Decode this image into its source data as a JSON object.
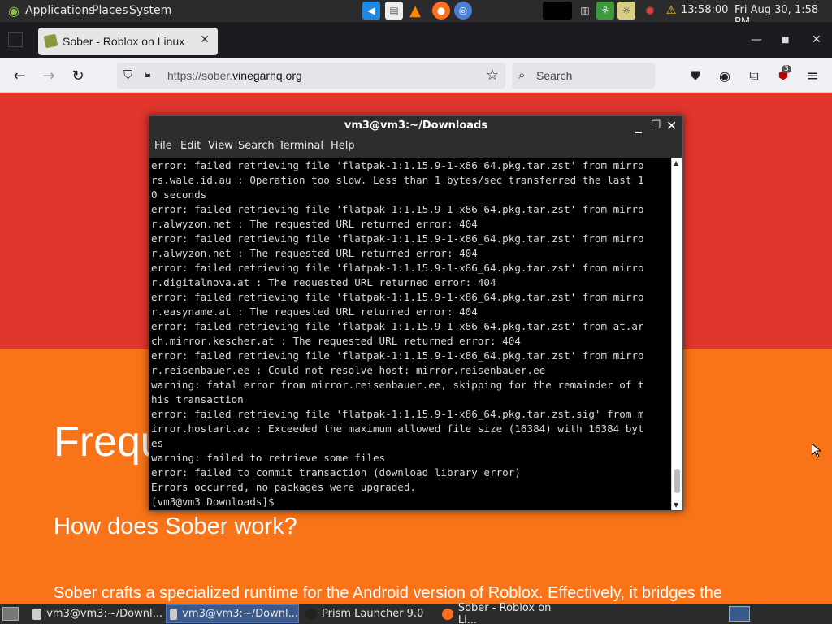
{
  "top_panel": {
    "menus": [
      "Applications",
      "Places",
      "System"
    ],
    "clock": "13:58:00",
    "date": "Fri Aug 30,  1:58 PM",
    "launchers": [
      "vscode-icon",
      "text-editor-icon",
      "vlc-icon",
      "firefox-icon",
      "chromium-icon"
    ],
    "tray": [
      "terminal-icon",
      "trash-icon",
      "image-viewer-icon",
      "weather-icon",
      "settings-icon",
      "alert-icon"
    ]
  },
  "browser": {
    "tab_title": "Sober - Roblox on Linux",
    "url_prefix": "https://sober.",
    "url_domain": "vinegarhq.org",
    "search_placeholder": "Search",
    "extension_badge": "3"
  },
  "page": {
    "faq_heading": "Frequ",
    "question": "How does Sober work?",
    "answer": "Sober crafts a specialized runtime for the Android version of Roblox. Effectively, it bridges the"
  },
  "terminal": {
    "title": "vm3@vm3:~/Downloads",
    "menus": [
      "File",
      "Edit",
      "View",
      "Search",
      "Terminal",
      "Help"
    ],
    "lines": [
      "error: failed retrieving file 'flatpak-1:1.15.9-1-x86_64.pkg.tar.zst' from mirro",
      "rs.wale.id.au : Operation too slow. Less than 1 bytes/sec transferred the last 1",
      "0 seconds",
      "error: failed retrieving file 'flatpak-1:1.15.9-1-x86_64.pkg.tar.zst' from mirro",
      "r.alwyzon.net : The requested URL returned error: 404",
      "error: failed retrieving file 'flatpak-1:1.15.9-1-x86_64.pkg.tar.zst' from mirro",
      "r.alwyzon.net : The requested URL returned error: 404",
      "error: failed retrieving file 'flatpak-1:1.15.9-1-x86_64.pkg.tar.zst' from mirro",
      "r.digitalnova.at : The requested URL returned error: 404",
      "error: failed retrieving file 'flatpak-1:1.15.9-1-x86_64.pkg.tar.zst' from mirro",
      "r.easyname.at : The requested URL returned error: 404",
      "error: failed retrieving file 'flatpak-1:1.15.9-1-x86_64.pkg.tar.zst' from at.ar",
      "ch.mirror.kescher.at : The requested URL returned error: 404",
      "error: failed retrieving file 'flatpak-1:1.15.9-1-x86_64.pkg.tar.zst' from mirro",
      "r.reisenbauer.ee : Could not resolve host: mirror.reisenbauer.ee",
      "warning: fatal error from mirror.reisenbauer.ee, skipping for the remainder of t",
      "his transaction",
      "error: failed retrieving file 'flatpak-1:1.15.9-1-x86_64.pkg.tar.zst.sig' from m",
      "irror.hostart.az : Exceeded the maximum allowed file size (16384) with 16384 byt",
      "es",
      "warning: failed to retrieve some files",
      "error: failed to commit transaction (download library error)",
      "Errors occurred, no packages were upgraded.",
      "[vm3@vm3 Downloads]$ "
    ]
  },
  "taskbar": {
    "tasks": [
      {
        "label": "vm3@vm3:~/Downl...",
        "icon": "terminal-icon",
        "active": false
      },
      {
        "label": "vm3@vm3:~/Downl...",
        "icon": "terminal-icon",
        "active": true
      },
      {
        "label": "Prism Launcher 9.0",
        "icon": "prism-icon",
        "active": false
      },
      {
        "label": "Sober - Roblox on Li...",
        "icon": "firefox-icon",
        "active": false
      }
    ]
  },
  "colors": {
    "page_red": "#e0362c",
    "page_orange": "#f97418",
    "panel_bg": "#2b2b2b",
    "terminal_bg": "#000000"
  }
}
